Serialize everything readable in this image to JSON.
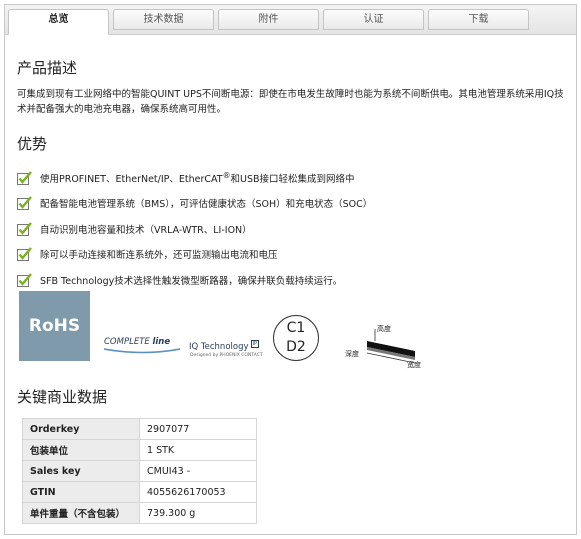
{
  "tabs": [
    {
      "label": "总览",
      "active": true
    },
    {
      "label": "技术数据",
      "active": false
    },
    {
      "label": "附件",
      "active": false
    },
    {
      "label": "认证",
      "active": false
    },
    {
      "label": "下载",
      "active": false
    }
  ],
  "product": {
    "heading": "产品描述",
    "description": "可集成到现有工业网络中的智能QUINT UPS不间断电源：即使在市电发生故障时也能为系统不间断供电。其电池管理系统采用IQ技术并配备强大的电池充电器，确保系统高可用性。"
  },
  "advantages": {
    "heading": "优势",
    "items": [
      {
        "pre": "使用PROFINET、EtherNet/IP、EtherCAT",
        "sup": "®",
        "post": "和USB接口轻松集成到网络中"
      },
      {
        "pre": "配备智能电池管理系统（BMS），可评估健康状态（SOH）和充电状态（SOC）",
        "sup": "",
        "post": ""
      },
      {
        "pre": "自动识别电池容量和技术（VRLA-WTR、LI-ION）",
        "sup": "",
        "post": ""
      },
      {
        "pre": "除可以手动连接和断连系统外，还可监测输出电流和电压",
        "sup": "",
        "post": ""
      },
      {
        "pre": "SFB Technology技术选择性触发微型断路器，确保并联负载持续运行。",
        "sup": "",
        "post": ""
      }
    ]
  },
  "logos": {
    "rohs": "RoHS",
    "complete_a": "COMPLETE",
    "complete_b": "line",
    "iq_a": "IQ Technology",
    "iq_sup": "IP",
    "iq_sub": "Designed by PHOENIX CONTACT",
    "c1": "C1",
    "d2": "D2",
    "dim_height": "高度",
    "dim_depth": "深度",
    "dim_width": "宽度"
  },
  "key_data": {
    "heading": "关键商业数据",
    "rows": [
      {
        "key": "Orderkey",
        "value": "2907077"
      },
      {
        "key": "包装单位",
        "value": "1 STK"
      },
      {
        "key": "Sales key",
        "value": "CMUI43 -"
      },
      {
        "key": "GTIN",
        "value": "4055626170053"
      },
      {
        "key": "单件重量（不含包装）",
        "value": "739.300 g"
      }
    ]
  },
  "colors": {
    "check_green": "#7bb21f",
    "rohs_bg": "#7f9aab"
  }
}
